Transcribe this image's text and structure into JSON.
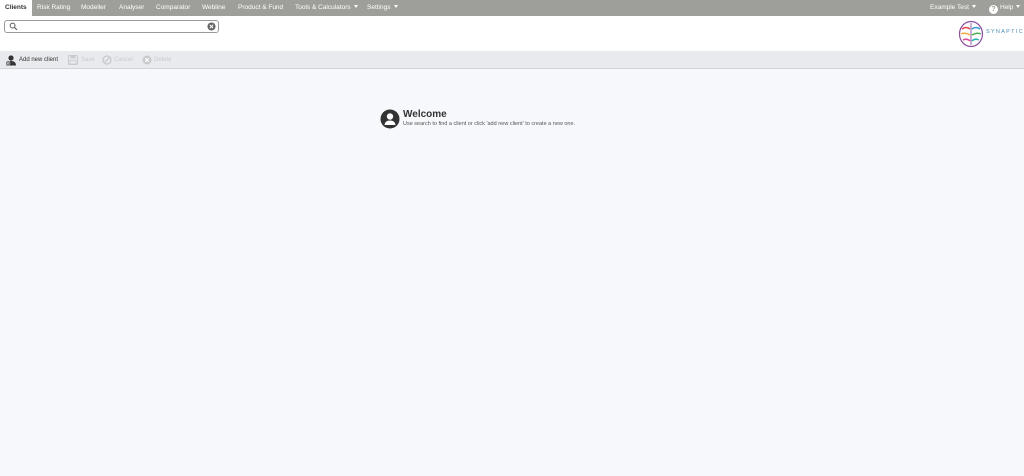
{
  "topnav": {
    "items": [
      {
        "label": "Clients",
        "active": true
      },
      {
        "label": "Risk Rating"
      },
      {
        "label": "Modeller"
      },
      {
        "label": "Analyser"
      },
      {
        "label": "Comparator"
      },
      {
        "label": "Webline"
      },
      {
        "label": "Product & Fund"
      },
      {
        "label": "Tools & Calculators"
      },
      {
        "label": "Settings"
      }
    ],
    "user_label": "Example Test",
    "help_label": "Help"
  },
  "search": {
    "value": "",
    "placeholder": ""
  },
  "logo": {
    "text": "SYNAPTIC"
  },
  "toolbar": {
    "add_label": "Add new client",
    "save_label": "Save",
    "cancel_label": "Cancel",
    "delete_label": "Delete"
  },
  "welcome": {
    "title": "Welcome",
    "text": "Use search to find a client or click 'add new client' to create a new one."
  },
  "colors": {
    "nav_bg": "#9e9f9a",
    "toolbar_bg": "#e9eaed",
    "page_bg": "#f7f8fc"
  }
}
